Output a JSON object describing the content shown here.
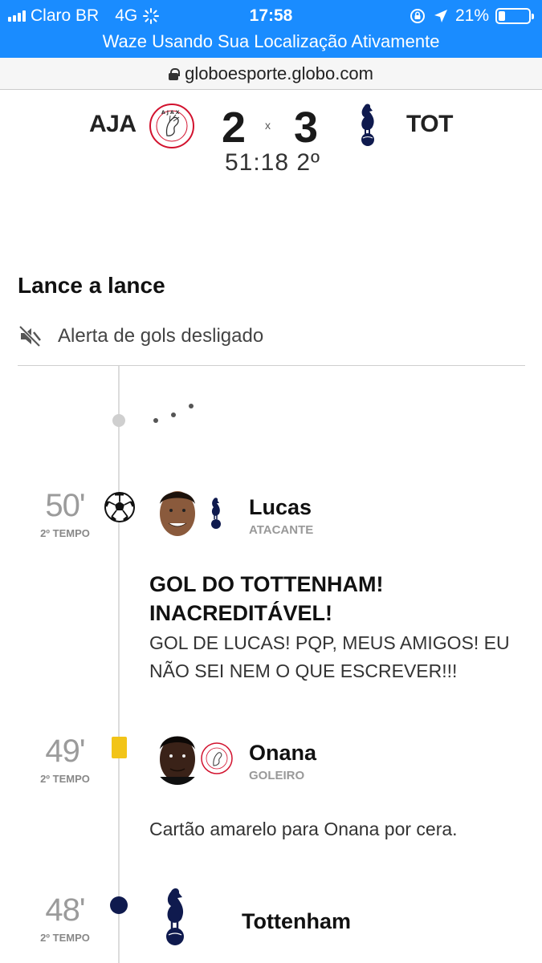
{
  "status_bar": {
    "carrier": "Claro BR",
    "network": "4G",
    "time": "17:58",
    "battery": "21%",
    "banner": "Waze Usando Sua Localização Ativamente",
    "bg_color": "#1a8cff"
  },
  "browser": {
    "url": "globoesporte.globo.com"
  },
  "match": {
    "home_abbr": "AJA",
    "home_score": "2",
    "separator": "x",
    "away_score": "3",
    "away_abbr": "TOT",
    "clock": "51:18 2º"
  },
  "feed": {
    "title": "Lance a lance",
    "alert_label": "Alerta de gols desligado",
    "events": [
      {
        "minute": "50'",
        "period": "2º TEMPO",
        "icon": "soccer-ball-icon",
        "player": "Lucas",
        "role": "ATACANTE",
        "team": "tottenham",
        "headline": "GOL DO TOTTENHAM! INACREDITÁVEL!",
        "text": "GOL DE LUCAS! PQP, MEUS AMIGOS! EU NÃO SEI NEM O QUE ESCREVER!!!"
      },
      {
        "minute": "49'",
        "period": "2º TEMPO",
        "icon": "yellow-card-icon",
        "player": "Onana",
        "role": "GOLEIRO",
        "team": "ajax",
        "text": "Cartão amarelo para Onana por cera."
      },
      {
        "minute": "48'",
        "period": "2º TEMPO",
        "icon": "navy-dot-icon",
        "player": "Tottenham",
        "team": "tottenham"
      }
    ]
  },
  "colors": {
    "yellow_card": "#f2c418",
    "tottenham_navy": "#0f1a4e",
    "ajax_red": "#d2122e"
  }
}
